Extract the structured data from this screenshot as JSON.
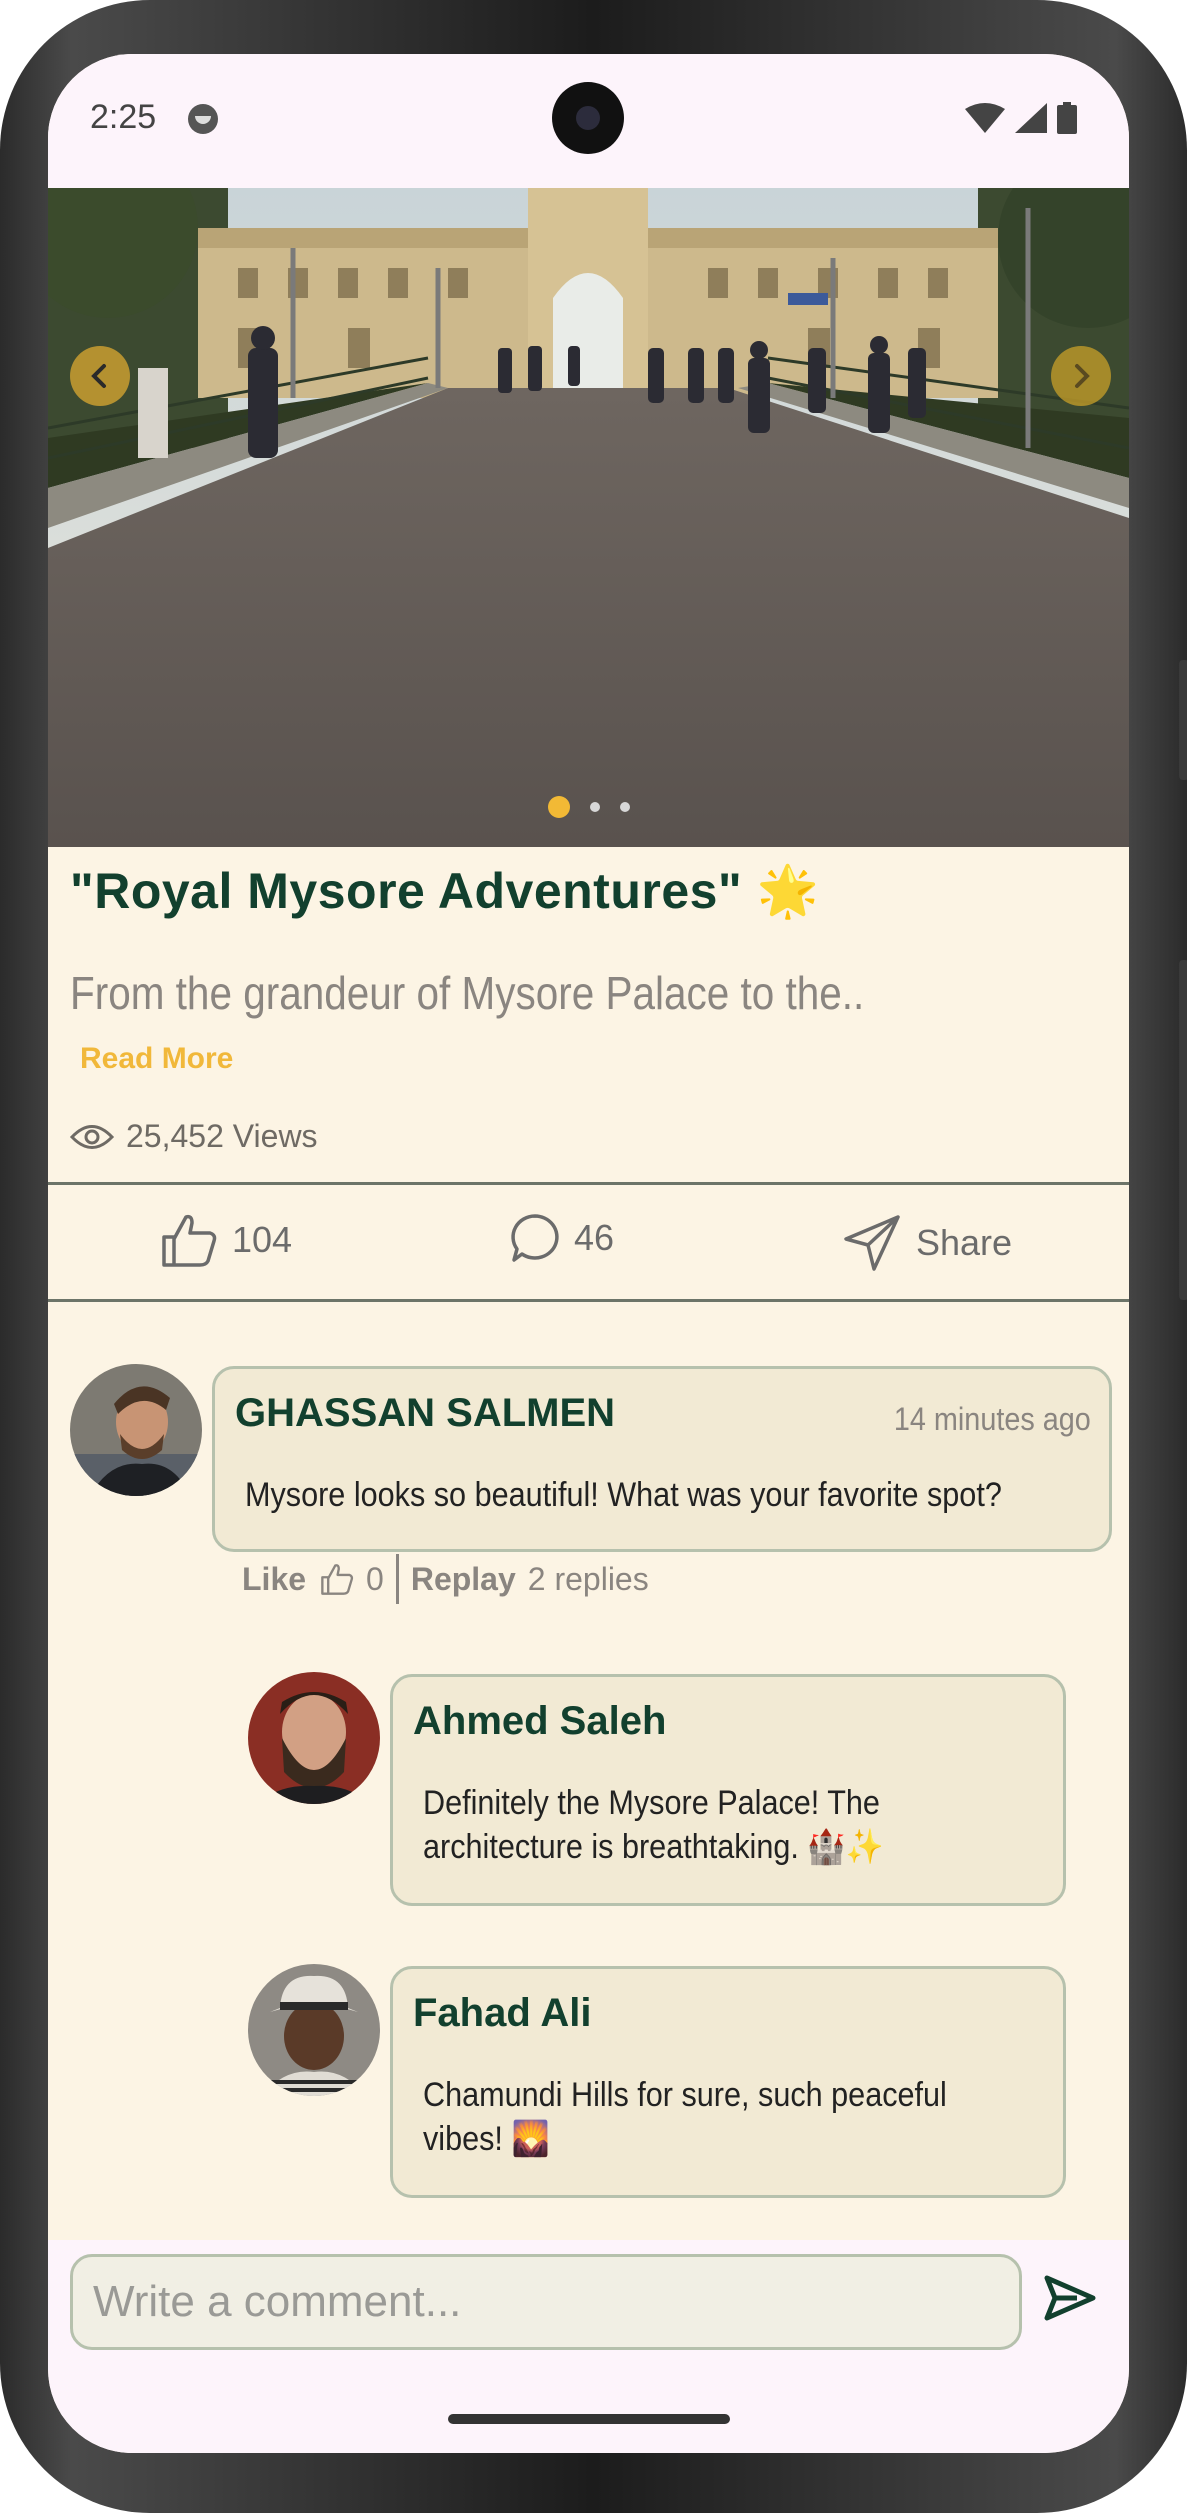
{
  "status_bar": {
    "time": "2:25"
  },
  "post": {
    "title": "\"Royal Mysore Adventures\" 🌟",
    "description": "From the grandeur of Mysore Palace to the..",
    "read_more": "Read More",
    "views": "25,452 Views",
    "carousel": {
      "page_count": 3,
      "active_index": 0
    }
  },
  "actions": {
    "likes": "104",
    "comments": "46",
    "share": "Share"
  },
  "comments": [
    {
      "name": "GHASSAN SALMEN",
      "time": "14 minutes ago",
      "text": "Mysore looks so beautiful! What was your favorite spot?",
      "like_label": "Like",
      "like_count": "0",
      "reply_label": "Replay",
      "replies_count": "2 replies",
      "replies": [
        {
          "name": "Ahmed Saleh",
          "text_line1": "Definitely the Mysore Palace! The",
          "text_line2": "architecture is breathtaking. 🏰✨"
        },
        {
          "name": "Fahad Ali",
          "text_line1": "Chamundi Hills for sure, such peaceful",
          "text_line2": "vibes! 🌄"
        }
      ]
    }
  ],
  "composer": {
    "placeholder": "Write a comment..."
  },
  "colors": {
    "brand_dark": "#12402e",
    "accent": "#f1b83a",
    "background": "#fcf4e4",
    "bubble": "#f2ead4"
  }
}
